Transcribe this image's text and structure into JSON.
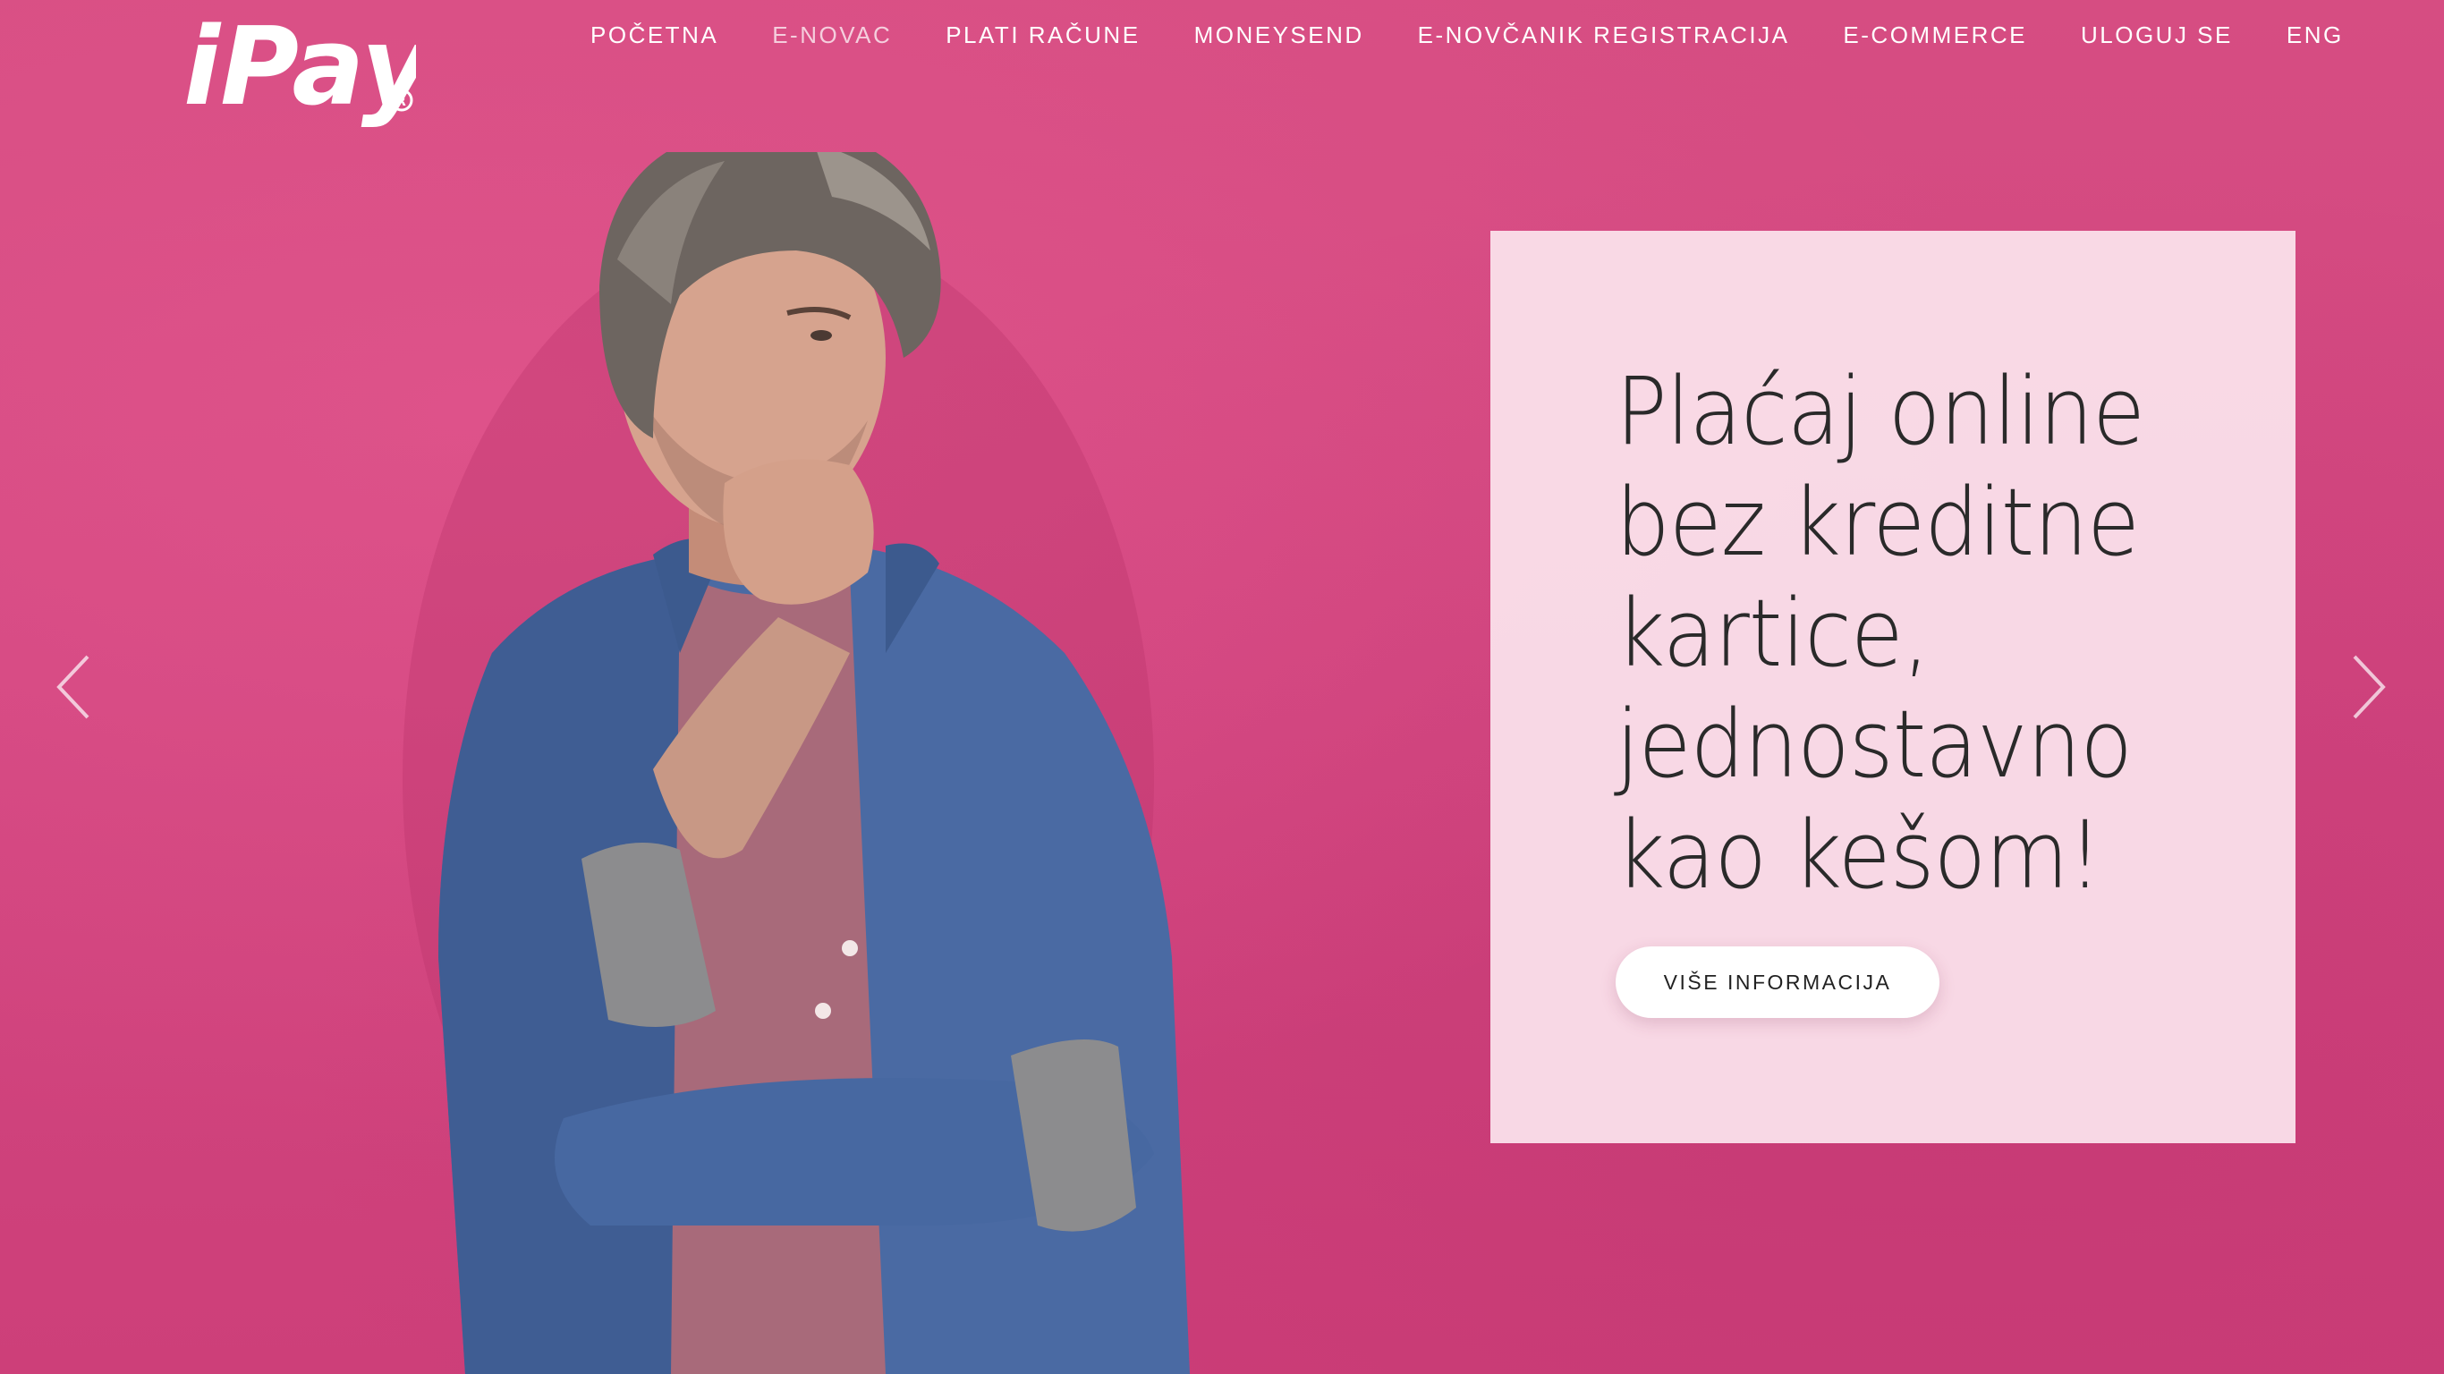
{
  "brand": {
    "logo_text": "iPay",
    "registered_mark": "®"
  },
  "nav": {
    "items": [
      {
        "label": "POČETNA",
        "state": "active"
      },
      {
        "label": "E-NOVAC",
        "state": "hover"
      },
      {
        "label": "PLATI RAČUNE",
        "state": "normal"
      },
      {
        "label": "MONEYSEND",
        "state": "normal"
      },
      {
        "label": "E-NOVČANIK REGISTRACIJA",
        "state": "normal"
      },
      {
        "label": "E-COMMERCE",
        "state": "normal"
      },
      {
        "label": "ULOGUJ SE",
        "state": "normal"
      },
      {
        "label": "ENG",
        "state": "normal"
      }
    ]
  },
  "hero": {
    "background_color": "#d4497e",
    "card_color": "#fadfe9",
    "headline_lines": [
      "Plaćaj online",
      "bez kreditne",
      "kartice,",
      "jednostavno",
      "kao kešom!"
    ],
    "cta_label": "VIŠE INFORMACIJA"
  },
  "slider": {
    "prev_icon": "chevron-left-icon",
    "next_icon": "chevron-right-icon"
  }
}
